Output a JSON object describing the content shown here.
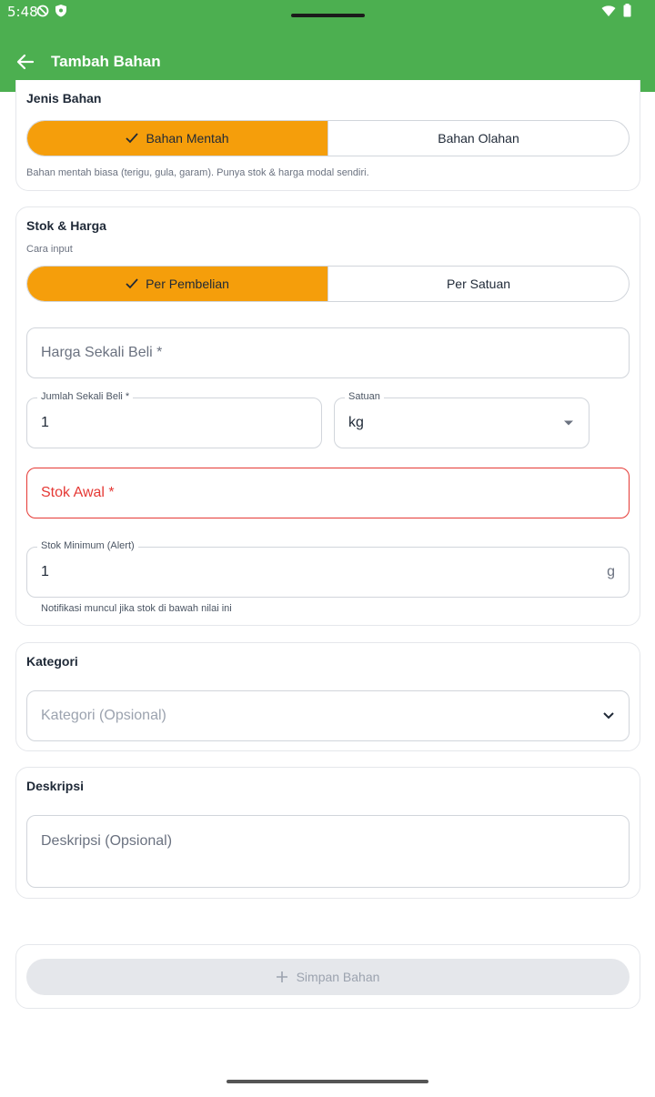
{
  "status": {
    "time": "5:48"
  },
  "appbar": {
    "title": "Tambah Bahan"
  },
  "jenis": {
    "title": "Jenis Bahan",
    "options": [
      "Bahan Mentah",
      "Bahan Olahan"
    ],
    "helper": "Bahan mentah biasa (terigu, gula, garam). Punya stok & harga modal sendiri."
  },
  "stok": {
    "title": "Stok & Harga",
    "cara_label": "Cara input",
    "options": [
      "Per Pembelian",
      "Per Satuan"
    ],
    "harga_placeholder": "Harga Sekali Beli *",
    "jumlah_label": "Jumlah Sekali Beli *",
    "jumlah_value": "1",
    "satuan_label": "Satuan",
    "satuan_value": "kg",
    "stok_awal_placeholder": "Stok Awal *",
    "stok_min_label": "Stok Minimum (Alert)",
    "stok_min_value": "1",
    "stok_min_suffix": "g",
    "stok_min_helper": "Notifikasi muncul jika stok di bawah nilai ini"
  },
  "kategori": {
    "title": "Kategori",
    "placeholder": "Kategori (Opsional)"
  },
  "deskripsi": {
    "title": "Deskripsi",
    "placeholder": "Deskripsi (Opsional)"
  },
  "save": {
    "label": "Simpan Bahan"
  },
  "colors": {
    "primary": "#4caf50",
    "accent": "#f59e0b",
    "error": "#e53935"
  }
}
